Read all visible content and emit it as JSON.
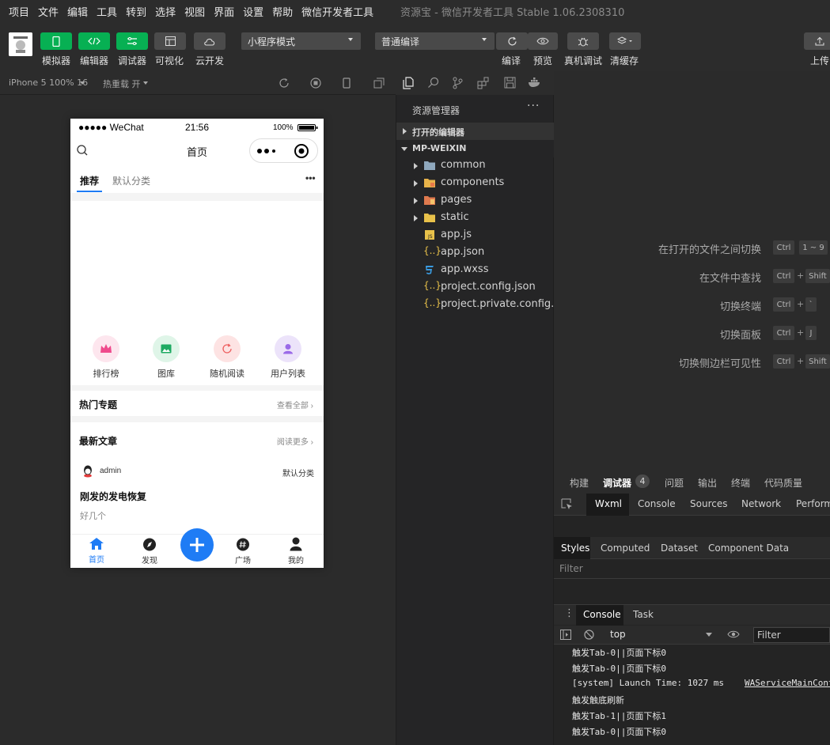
{
  "menubar": {
    "items": [
      "项目",
      "文件",
      "编辑",
      "工具",
      "转到",
      "选择",
      "视图",
      "界面",
      "设置",
      "帮助",
      "微信开发者工具"
    ],
    "window_title": "资源宝 - 微信开发者工具 Stable 1.06.2308310"
  },
  "toolbar": {
    "buttons": [
      {
        "label": "模拟器",
        "icon": "phone-icon",
        "style": "green"
      },
      {
        "label": "编辑器",
        "icon": "code-icon",
        "style": "green"
      },
      {
        "label": "调试器",
        "icon": "sliders-icon",
        "style": "green"
      },
      {
        "label": "可视化",
        "icon": "layout-icon",
        "style": "gray"
      },
      {
        "label": "云开发",
        "icon": "cloud-icon",
        "style": "gray"
      }
    ],
    "mode_select": "小程序模式",
    "compile_select": "普通编译",
    "compile_label": "编译",
    "preview_label": "预览",
    "remote_debug_label": "真机调试",
    "clear_cache_label": "清缓存",
    "upload_label": "上传"
  },
  "simulator": {
    "device": "iPhone 5 100% 16",
    "hot_reload": "热重载 开"
  },
  "phone": {
    "status": {
      "carrier": "●●●●● WeChat",
      "time": "21:56",
      "battery": "100%"
    },
    "nav_title": "首页",
    "tabs": [
      "推荐",
      "默认分类"
    ],
    "grid": [
      {
        "label": "排行榜",
        "color": "#fde6ee",
        "icon_color": "#ef4a8c",
        "icon": "crown-icon"
      },
      {
        "label": "图库",
        "color": "#dff5e8",
        "icon_color": "#1eaa62",
        "icon": "image-icon"
      },
      {
        "label": "随机阅读",
        "color": "#fde3e3",
        "icon_color": "#ee5f5f",
        "icon": "refresh-icon"
      },
      {
        "label": "用户列表",
        "color": "#ece3fa",
        "icon_color": "#9a6ae8",
        "icon": "user-icon"
      }
    ],
    "hot_topics": {
      "title": "热门专题",
      "more": "查看全部"
    },
    "latest": {
      "title": "最新文章",
      "more": "阅读更多"
    },
    "article": {
      "author": "admin",
      "category": "默认分类",
      "title": "刚发的发电恢复",
      "excerpt": "好几个"
    },
    "tabbar": [
      {
        "label": "首页",
        "icon": "home-icon",
        "active": true
      },
      {
        "label": "发现",
        "icon": "compass-icon",
        "active": false
      },
      {
        "label": "广场",
        "icon": "hash-icon",
        "active": false
      },
      {
        "label": "我的",
        "icon": "person-icon",
        "active": false
      }
    ]
  },
  "explorer": {
    "title": "资源管理器",
    "open_editors": "打开的编辑器",
    "project": "MP-WEIXIN",
    "files": [
      {
        "name": "common",
        "type": "folder",
        "icon_color": "#8fa8bd",
        "expandable": true
      },
      {
        "name": "components",
        "type": "folder",
        "icon_color": "#e8b34a",
        "expandable": true
      },
      {
        "name": "pages",
        "type": "folder",
        "icon_color": "#e07a4e",
        "expandable": true
      },
      {
        "name": "static",
        "type": "folder",
        "icon_color": "#e8c14a",
        "expandable": true
      },
      {
        "name": "app.js",
        "type": "js",
        "icon_color": "#e8c14a",
        "expandable": false
      },
      {
        "name": "app.json",
        "type": "json",
        "icon_color": "#e8c14a",
        "expandable": false
      },
      {
        "name": "app.wxss",
        "type": "wxss",
        "icon_color": "#3a9be0",
        "expandable": false
      },
      {
        "name": "project.config.json",
        "type": "json",
        "icon_color": "#e8c14a",
        "expandable": false
      },
      {
        "name": "project.private.config.js...",
        "type": "json",
        "icon_color": "#e8c14a",
        "expandable": false
      }
    ]
  },
  "shortcuts": [
    {
      "label": "在打开的文件之间切换",
      "keys": [
        "Ctrl",
        "1 ~ 9"
      ]
    },
    {
      "label": "在文件中查找",
      "keys": [
        "Ctrl",
        "Shift"
      ]
    },
    {
      "label": "切换终端",
      "keys": [
        "Ctrl",
        "`"
      ]
    },
    {
      "label": "切换面板",
      "keys": [
        "Ctrl",
        "J"
      ]
    },
    {
      "label": "切换侧边栏可见性",
      "keys": [
        "Ctrl",
        "Shift"
      ]
    }
  ],
  "devtools": {
    "tabs": [
      "构建",
      "调试器",
      "问题",
      "输出",
      "终端",
      "代码质量"
    ],
    "debugger_badge": "4",
    "subtabs": [
      "Wxml",
      "Console",
      "Sources",
      "Network",
      "Perform"
    ],
    "style_tabs": [
      "Styles",
      "Computed",
      "Dataset",
      "Component Data"
    ],
    "filter_placeholder": "Filter",
    "console_tabs": [
      "Console",
      "Task"
    ],
    "context": "top",
    "console_filter": "Filter",
    "console_lines": [
      "触发Tab-0||页面下标0",
      "触发Tab-0||页面下标0",
      "[system] Launch Time: 1027 ms",
      "触发触底刷新",
      "触发Tab-1||页面下标1",
      "触发Tab-0||页面下标0"
    ],
    "console_link": "WAServiceMainCont"
  }
}
